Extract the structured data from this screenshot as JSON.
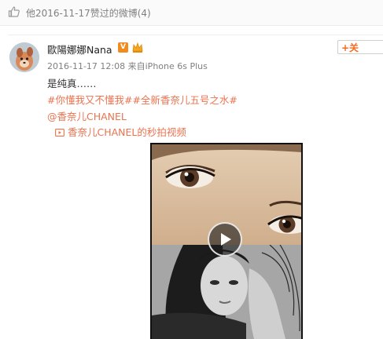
{
  "like_header": {
    "text": "他2016-11-17赞过的微博(4)"
  },
  "post": {
    "author": {
      "name": "歐陽娜娜Nana",
      "vip_badge": "V"
    },
    "follow_button": {
      "label": "+关"
    },
    "meta": {
      "time": "2016-11-17 12:08",
      "source_prefix": "来自",
      "source_device": "iPhone 6s Plus"
    },
    "text": "是纯真……",
    "topics": "#你懂我又不懂我##全新香奈儿五号之水#",
    "mention": "@香奈儿CHANEL",
    "video_link": {
      "icon": "video-icon",
      "text": "香奈儿CHANEL的秒拍视频"
    },
    "video": {
      "play_icon": "play-icon"
    }
  },
  "colors": {
    "link": "#eb7350",
    "meta_gray": "#808080",
    "vip_orange": "#f08c1e",
    "follow_plus": "#f76a1e"
  }
}
